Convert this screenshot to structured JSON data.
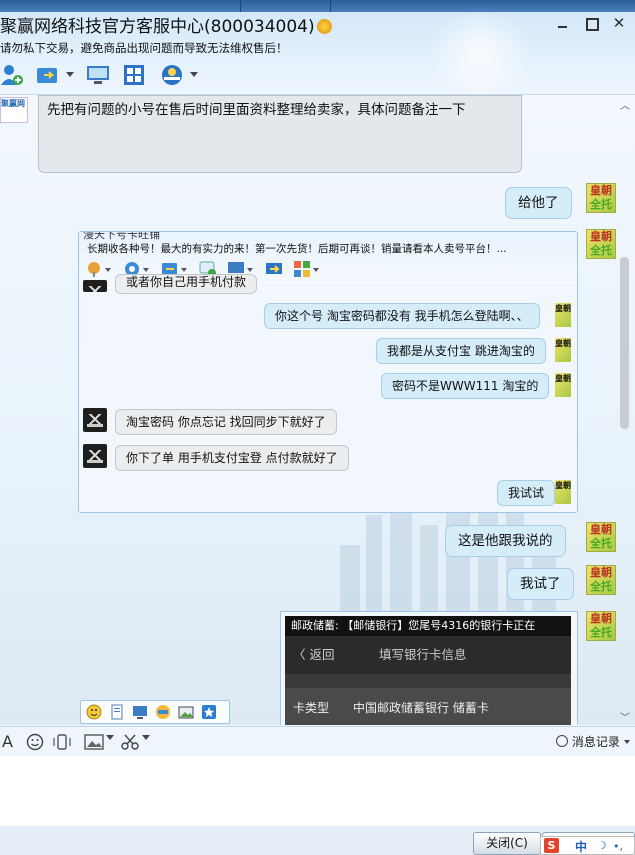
{
  "window": {
    "title": "聚赢网络科技官方客服中心(800034004)",
    "notice": "请勿私下交易，避免商品出现问题而导致无法维权售后！"
  },
  "toolbar": {
    "icons": [
      "add-contact-icon",
      "file-transfer-icon",
      "remote-desktop-icon",
      "app-center-icon",
      "more-apps-icon"
    ]
  },
  "messages": {
    "m1": "先把有问题的小号在售后时间里面资料整理给卖家，具体问题备注一下",
    "m2": "给他了",
    "m3": "这是他跟我说的",
    "m4": "我试了"
  },
  "avatar": {
    "line1": "皇朝",
    "line2": "全托"
  },
  "forwarded": {
    "cut_title": "漫天下号卡旺铺",
    "subtitle": "长期收各种号！最大的有实力的来！第一次先货！后期可再谈！销量请看本人卖号平台！...",
    "cut_msg": "或者你自己用手机付款",
    "msgs": [
      {
        "side": "right",
        "text": "你这个号 淘宝密码都没有 我手机怎么登陆啊、、"
      },
      {
        "side": "right",
        "text": "我都是从支付宝 跳进淘宝的"
      },
      {
        "side": "right",
        "text": "密码不是WWW111 淘宝的"
      },
      {
        "side": "left",
        "text": "淘宝密码   你点忘记  找回同步下就好了"
      },
      {
        "side": "left",
        "text": "你下了单  用手机支付宝登  点付款就好了"
      },
      {
        "side": "right",
        "text": "我试试"
      }
    ]
  },
  "screenshot": {
    "status": "邮政储蓄: 【邮储银行】您尾号4316的银行卡正在",
    "back": "〈 返回",
    "title": "填写银行卡信息",
    "row_key": "卡类型",
    "row_val": "中国邮政储蓄银行  储蓄卡"
  },
  "formatbar": {
    "history": "消息记录"
  },
  "buttons": {
    "close": "关闭(C)"
  },
  "ime": {
    "logo": "S",
    "mode": "中"
  }
}
